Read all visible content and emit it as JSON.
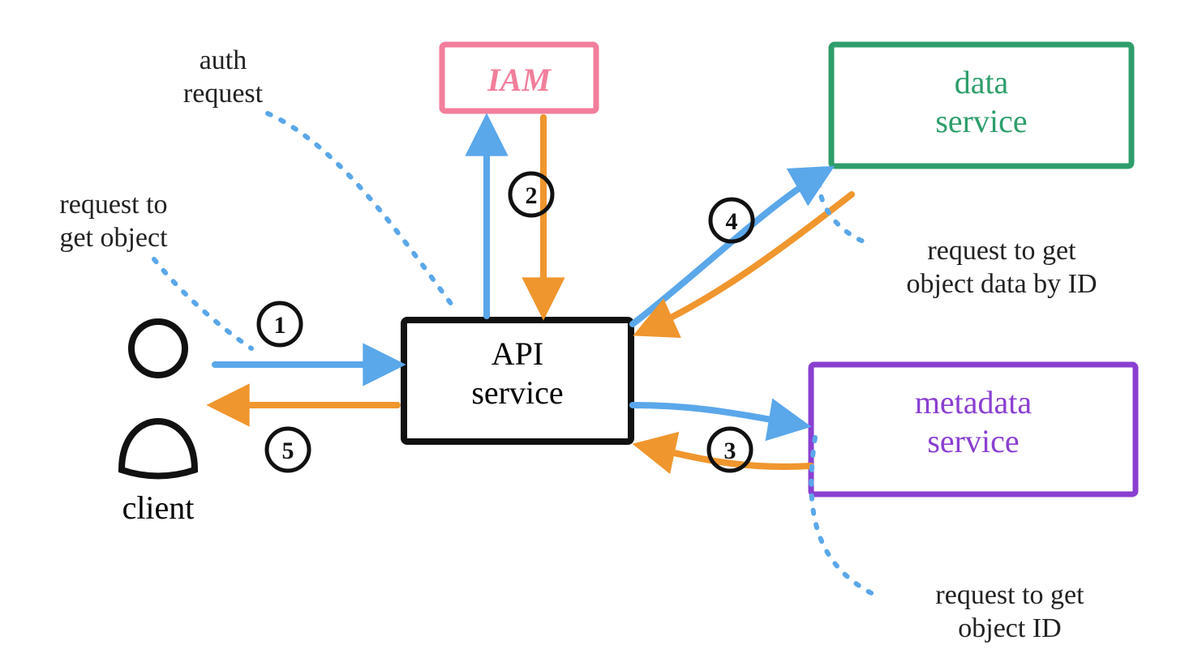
{
  "nodes": {
    "client": "client",
    "api": "API\nservice",
    "iam": "IAM",
    "data": "data\nservice",
    "metadata": "metadata\nservice"
  },
  "annotations": {
    "auth": "auth\nrequest",
    "reqObj": "request to\nget object",
    "reqData": "request to get\nobject data by ID",
    "reqMeta": "request to get\nobject ID"
  },
  "steps": {
    "s1": "1",
    "s2": "2",
    "s3": "3",
    "s4": "4",
    "s5": "5"
  },
  "colors": {
    "blue": "#5aa7ea",
    "orange": "#f0962e",
    "pink": "#f27e9b",
    "green": "#2e9e6b",
    "purple": "#8a3fd1",
    "black": "#111"
  }
}
